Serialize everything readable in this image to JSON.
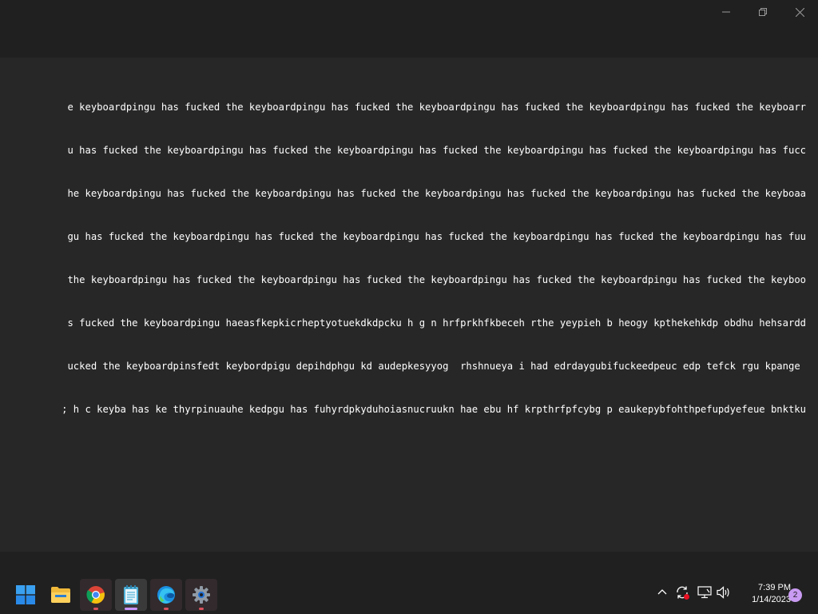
{
  "window": {
    "controls": [
      {
        "name": "minimize-button",
        "icon": "minimize-icon"
      },
      {
        "name": "restore-button",
        "icon": "restore-icon"
      },
      {
        "name": "close-button",
        "icon": "close-icon"
      }
    ]
  },
  "editor": {
    "lines": [
      "e keyboardpingu has fucked the keyboardpingu has fucked the keyboardpingu has fucked the keyboardpingu has fucked the keyboarr",
      "u has fucked the keyboardpingu has fucked the keyboardpingu has fucked the keyboardpingu has fucked the keyboardpingu has fucc",
      "he keyboardpingu has fucked the keyboardpingu has fucked the keyboardpingu has fucked the keyboardpingu has fucked the keyboaa",
      "gu has fucked the keyboardpingu has fucked the keyboardpingu has fucked the keyboardpingu has fucked the keyboardpingu has fuu",
      "the keyboardpingu has fucked the keyboardpingu has fucked the keyboardpingu has fucked the keyboardpingu has fucked the keyboo",
      "s fucked the keyboardpingu haeasfkepkicrheptyotuekdkdpcku h g n hrfprkhfkbeceh rthe yeypieh b heogy kpthekehkdp obdhu hehsardd",
      "ucked the keyboardpinsfedt keybordpigu depihdphgu kd audepkesyyog  rhshnueya i had edrdaygubifuckeedpeuc edp tefck rgu kpange ",
      "; h c keyba has ke thyrpinuauhe kedpgu has fuhyrdpkyduhoiasnucruukn hae ebu hf krpthrfpfcybg p eaukepybfohthpefupdyefeue bnktku"
    ]
  },
  "taskbar": {
    "apps": [
      {
        "name": "start-button",
        "icon": "windows-logo-icon",
        "state": "none"
      },
      {
        "name": "file-explorer-button",
        "icon": "folder-icon",
        "state": "none"
      },
      {
        "name": "chrome-button",
        "icon": "chrome-icon",
        "state": "running"
      },
      {
        "name": "notepad-button",
        "icon": "notepad-icon",
        "state": "active"
      },
      {
        "name": "edge-button",
        "icon": "edge-icon",
        "state": "running"
      },
      {
        "name": "settings-button",
        "icon": "gear-icon",
        "state": "running"
      }
    ],
    "tray": {
      "icons": [
        "chevron-up-icon",
        "sync-error-icon",
        "network-icon",
        "volume-icon"
      ]
    },
    "clock": {
      "time": "7:39 PM",
      "date": "1/14/2023"
    },
    "notifications": {
      "count": "2"
    }
  },
  "colors": {
    "background": "#272727",
    "titlebar": "#202020",
    "taskbar": "#202020",
    "text": "#ffffff",
    "running_indicator": "#d8525d",
    "active_indicator": "#c794ff",
    "badge": "#c99bf2"
  }
}
